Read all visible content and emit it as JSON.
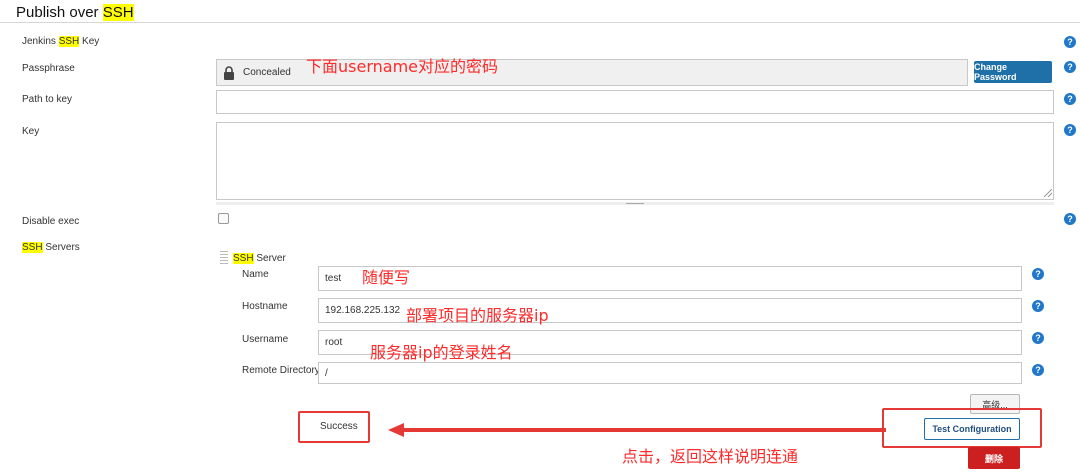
{
  "section": {
    "title_pre": "Publish over ",
    "title_hl": "SSH"
  },
  "fields": {
    "jenkins_key": {
      "pre": "Jenkins ",
      "hl": "SSH",
      "post": " Key"
    },
    "passphrase": {
      "label": "Passphrase",
      "value": "Concealed",
      "button": "Change Password"
    },
    "path_to_key": {
      "label": "Path to key",
      "value": ""
    },
    "key": {
      "label": "Key",
      "value": ""
    },
    "disable_exec": {
      "label": "Disable exec",
      "checked": false
    },
    "ssh_servers": {
      "hl": "SSH",
      "post": " Servers"
    }
  },
  "server": {
    "header_hl": "SSH",
    "header_post": " Server",
    "name": {
      "label": "Name",
      "value": "test"
    },
    "hostname": {
      "label": "Hostname",
      "value": "192.168.225.132"
    },
    "username": {
      "label": "Username",
      "value": "root"
    },
    "remote_directory": {
      "label": "Remote Directory",
      "value": "/"
    },
    "advanced_button": "高级...",
    "status": "Success",
    "test_button": "Test Configuration",
    "delete_button": "删除"
  },
  "help_glyph": "?",
  "annotations": {
    "passphrase_note": "下面username对应的密码",
    "name_note": "随便写",
    "hostname_note": "部署项目的服务器ip",
    "username_note": "服务器ip的登录姓名",
    "test_note": "点击，返回这样说明连通"
  },
  "colors": {
    "accent": "#1f6fa8",
    "highlight": "#ffff00",
    "annotation": "#ff2a2a",
    "danger": "#cc1f1f"
  }
}
